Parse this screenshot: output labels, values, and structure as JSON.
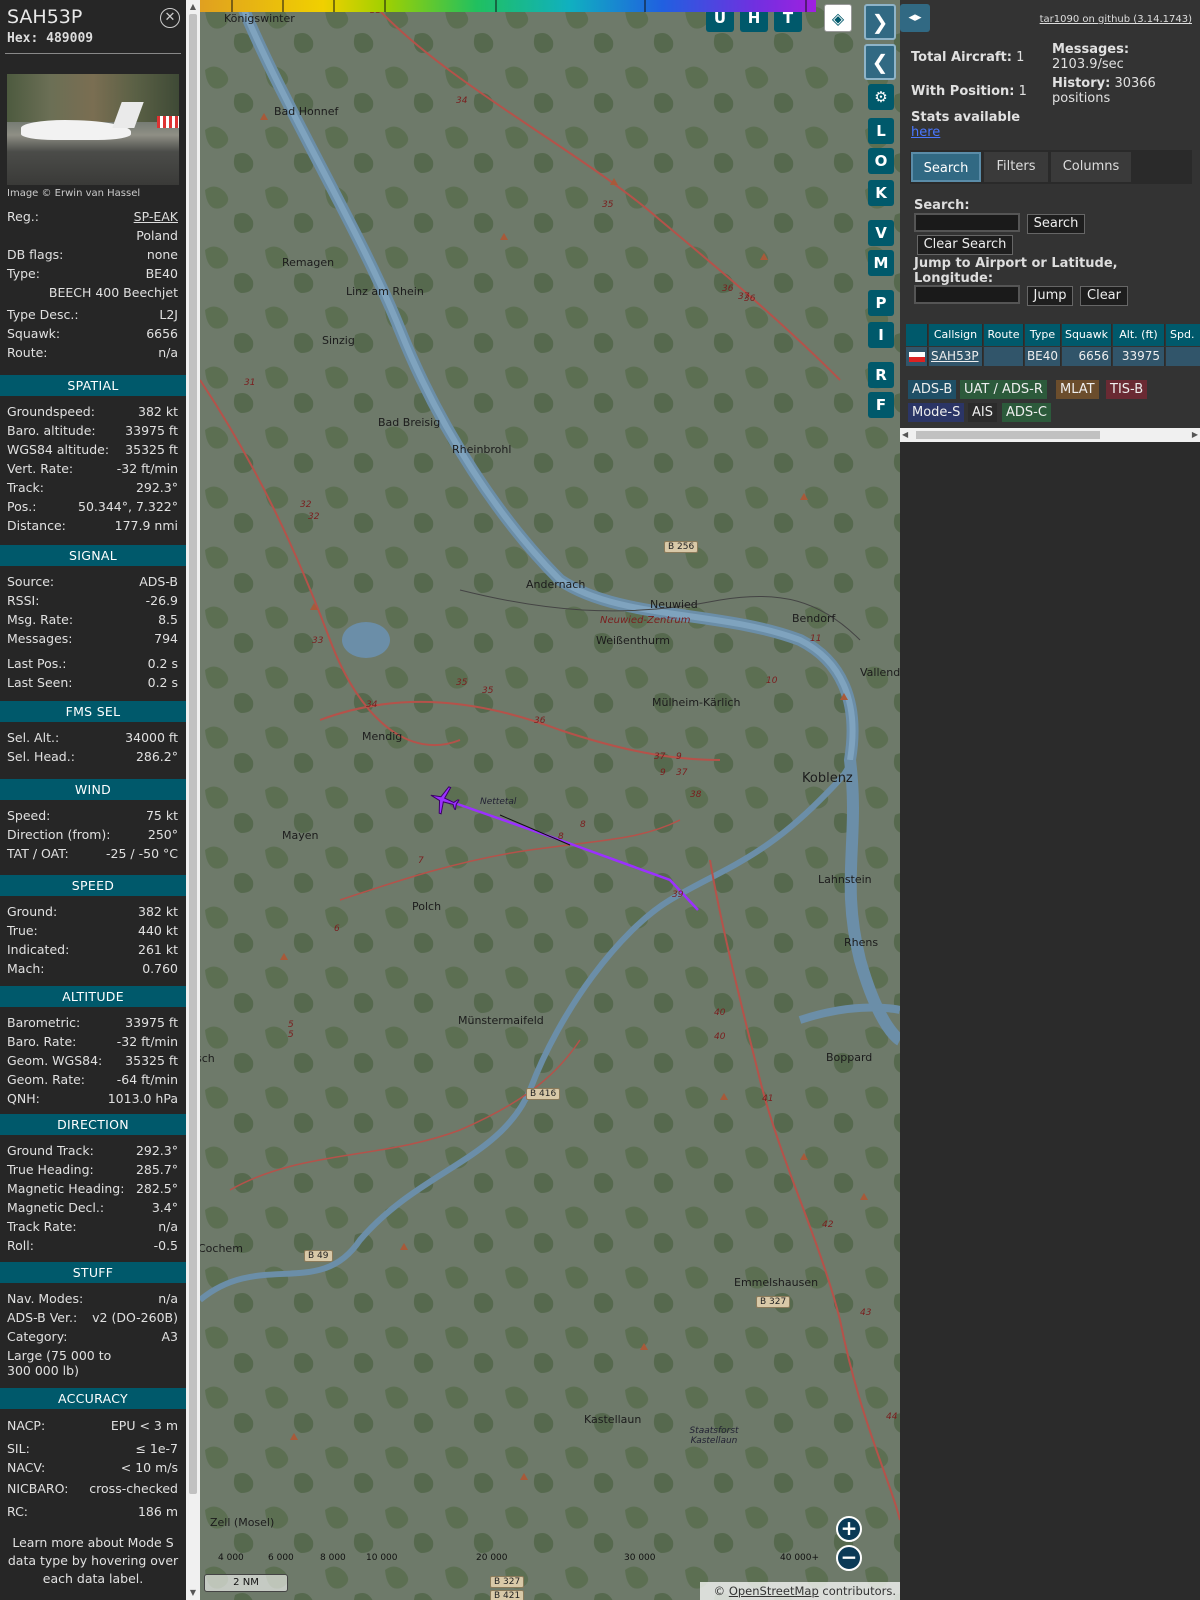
{
  "sidebar": {
    "callsign": "SAH53P",
    "hex_label": "Hex:",
    "hex": "489009",
    "image_credit": "Image © Erwin van Hassel",
    "basic": [
      {
        "k": "Reg.:",
        "v": "SP-EAK"
      },
      {
        "k": "",
        "v": "Poland"
      },
      {
        "k": "DB flags:",
        "v": "none"
      },
      {
        "k": "Type:",
        "v": "BE40"
      },
      {
        "k": "",
        "v": "BEECH 400 Beechjet"
      },
      {
        "k": "Type Desc.:",
        "v": "L2J"
      },
      {
        "k": "Squawk:",
        "v": "6656"
      },
      {
        "k": "Route:",
        "v": "n/a"
      }
    ],
    "sections": [
      {
        "title": "SPATIAL",
        "rows": [
          {
            "k": "Groundspeed:",
            "v": "382 kt"
          },
          {
            "k": "Baro. altitude:",
            "v": "33975 ft"
          },
          {
            "k": "WGS84 altitude:",
            "v": "35325 ft"
          },
          {
            "k": "Vert. Rate:",
            "v": "-32 ft/min"
          },
          {
            "k": "Track:",
            "v": "292.3°"
          },
          {
            "k": "Pos.:",
            "v": "50.344°, 7.322°"
          },
          {
            "k": "Distance:",
            "v": "177.9 nmi"
          }
        ]
      },
      {
        "title": "SIGNAL",
        "rows": [
          {
            "k": "Source:",
            "v": "ADS-B"
          },
          {
            "k": "RSSI:",
            "v": "-26.9"
          },
          {
            "k": "Msg. Rate:",
            "v": "8.5"
          },
          {
            "k": "Messages:",
            "v": "794"
          },
          {
            "k": "Last Pos.:",
            "v": "0.2 s"
          },
          {
            "k": "Last Seen:",
            "v": "0.2 s"
          }
        ]
      },
      {
        "title": "FMS SEL",
        "rows": [
          {
            "k": "Sel. Alt.:",
            "v": "34000 ft"
          },
          {
            "k": "Sel. Head.:",
            "v": "286.2°"
          }
        ]
      },
      {
        "title": "WIND",
        "rows": [
          {
            "k": "Speed:",
            "v": "75 kt"
          },
          {
            "k": "Direction (from):",
            "v": "250°"
          },
          {
            "k": "TAT / OAT:",
            "v": "-25 / -50 °C"
          }
        ]
      },
      {
        "title": "SPEED",
        "rows": [
          {
            "k": "Ground:",
            "v": "382 kt"
          },
          {
            "k": "True:",
            "v": "440 kt"
          },
          {
            "k": "Indicated:",
            "v": "261 kt"
          },
          {
            "k": "Mach:",
            "v": "0.760"
          }
        ]
      },
      {
        "title": "ALTITUDE",
        "rows": [
          {
            "k": "Barometric:",
            "v": "33975 ft"
          },
          {
            "k": "Baro. Rate:",
            "v": "-32 ft/min"
          },
          {
            "k": "Geom. WGS84:",
            "v": "35325 ft"
          },
          {
            "k": "Geom. Rate:",
            "v": "-64 ft/min"
          },
          {
            "k": "QNH:",
            "v": "1013.0 hPa"
          }
        ]
      },
      {
        "title": "DIRECTION",
        "rows": [
          {
            "k": "Ground Track:",
            "v": "292.3°"
          },
          {
            "k": "True Heading:",
            "v": "285.7°"
          },
          {
            "k": "Magnetic Heading:",
            "v": "282.5°"
          },
          {
            "k": "Magnetic Decl.:",
            "v": "3.4°"
          },
          {
            "k": "Track Rate:",
            "v": "n/a"
          },
          {
            "k": "Roll:",
            "v": "-0.5"
          }
        ]
      },
      {
        "title": "STUFF",
        "rows": [
          {
            "k": "Nav. Modes:",
            "v": "n/a"
          },
          {
            "k": "ADS-B Ver.:",
            "v": "v2 (DO-260B)"
          },
          {
            "k": "Category:",
            "v": "A3"
          },
          {
            "k": "Large (75 000 to 300 000 lb)",
            "v": ""
          }
        ]
      },
      {
        "title": "ACCURACY",
        "rows": [
          {
            "k": "NACP:",
            "v": "EPU < 3 m"
          },
          {
            "k": "SIL:",
            "v": "≤ 1e-7"
          },
          {
            "k": "NACV:",
            "v": "< 10 m/s"
          },
          {
            "k": "NICBARO:",
            "v": "cross-checked"
          },
          {
            "k": "RC:",
            "v": "186 m"
          }
        ]
      }
    ],
    "learn_more": "Learn more about Mode S data type by hovering over each data label."
  },
  "map": {
    "places": [
      "Königswinter",
      "Bad Honnef",
      "Remagen",
      "Linz am Rhein",
      "Sinzig",
      "Bad Breisig",
      "Rheinbrohl",
      "Andernach",
      "Neuwied",
      "Neuwied-Zentrum",
      "Weißenthurm",
      "Bendorf",
      "Vallendar",
      "Mülheim-Kärlich",
      "Mendig",
      "Koblenz",
      "Nettetal",
      "Mayen",
      "Lahnstein",
      "Polch",
      "Rhens",
      "Münstermaifeld",
      "Boppard",
      "Emmelshausen",
      "Cochem",
      "Kastellaun",
      "Staatsforst Kastellaun",
      "Zell (Mosel)",
      "sch"
    ],
    "roads": [
      "B 256",
      "B 416",
      "B 49",
      "B 327",
      "B 327",
      "B 421"
    ],
    "route_numbers": [
      "33",
      "34",
      "35",
      "36",
      "37",
      "31",
      "32",
      "32",
      "33",
      "35",
      "35",
      "34",
      "36",
      "37",
      "9",
      "9",
      "37",
      "38",
      "8",
      "8",
      "10",
      "11",
      "39",
      "6",
      "5",
      "5",
      "7",
      "40",
      "40",
      "41",
      "42",
      "43",
      "44",
      "36"
    ],
    "map_buttons": [
      "U",
      "H",
      "T"
    ],
    "side_buttons": [
      "L",
      "O",
      "K",
      "V",
      "M",
      "P",
      "I",
      "R",
      "F"
    ],
    "altitude_ticks": [
      "4 000",
      "6 000",
      "8 000",
      "10 000",
      "20 000",
      "30 000",
      "40 000+"
    ],
    "scale": "2 NM",
    "attribution_prefix": "© ",
    "attribution_link": "OpenStreetMap",
    "attribution_suffix": " contributors."
  },
  "panel": {
    "github": "tar1090 on github (3.14.1743)",
    "total_aircraft_label": "Total Aircraft:",
    "total_aircraft": "1",
    "with_position_label": "With Position:",
    "with_position": "1",
    "stats_label": "Stats available",
    "stats_link": "here",
    "messages_label": "Messages:",
    "messages": "2103.9/sec",
    "history_label": "History:",
    "history_count": "30366",
    "history_unit": "positions",
    "tabs": [
      "Search",
      "Filters",
      "Columns"
    ],
    "search_label": "Search:",
    "search_button": "Search",
    "clear_search_button": "Clear Search",
    "jump_label": "Jump to Airport or Latitude, Longitude:",
    "jump_button": "Jump",
    "clear_button": "Clear",
    "table_headers": [
      "",
      "Callsign",
      "Route",
      "Type",
      "Squawk",
      "Alt. (ft)",
      "Spd."
    ],
    "table_row": {
      "callsign": "SAH53P",
      "route": "",
      "type": "BE40",
      "squawk": "6656",
      "alt": "33975",
      "spd": ""
    },
    "badges": [
      {
        "label": "ADS-B",
        "color": "#1f4f66"
      },
      {
        "label": "UAT / ADS-R",
        "color": "#2c5a3b"
      },
      {
        "label": "MLAT",
        "color": "#6b4d2c"
      },
      {
        "label": "TIS-B",
        "color": "#6a2a33"
      },
      {
        "label": "Mode-S",
        "color": "#2b3566"
      },
      {
        "label": "AIS",
        "color": "#2b2b2b"
      },
      {
        "label": "ADS-C",
        "color": "#2c5a3b"
      }
    ]
  }
}
